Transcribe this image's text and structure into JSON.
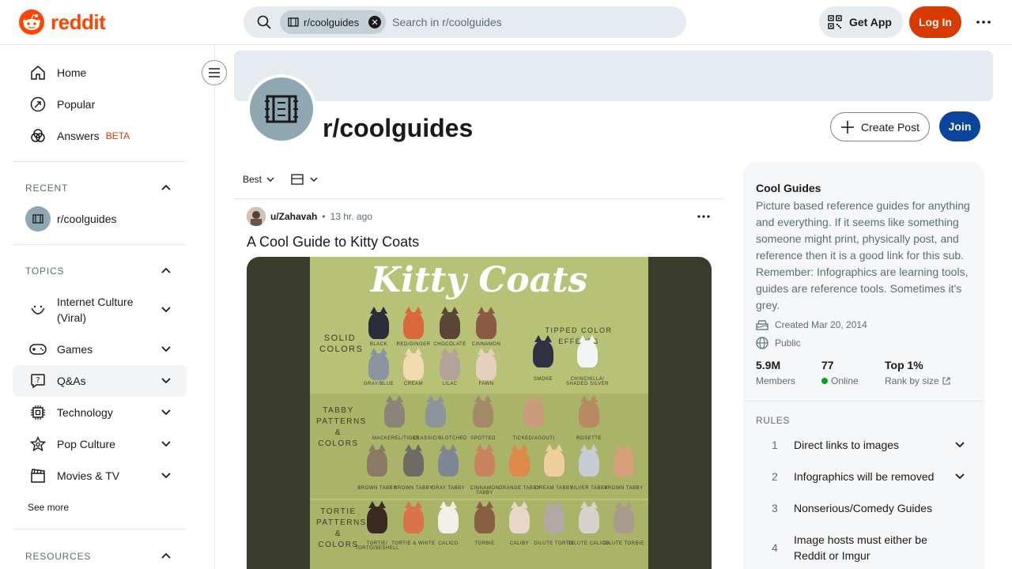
{
  "header": {
    "logo_text": "reddit",
    "search_chip": "r/coolguides",
    "search_placeholder": "Search in r/coolguides",
    "get_app_label": "Get App",
    "login_label": "Log In"
  },
  "sidebar": {
    "main": [
      {
        "label": "Home",
        "icon": "home-icon"
      },
      {
        "label": "Popular",
        "icon": "popular-icon"
      },
      {
        "label": "Answers",
        "badge": "BETA",
        "icon": "answers-icon"
      }
    ],
    "recent_title": "RECENT",
    "recent": [
      {
        "label": "r/coolguides"
      }
    ],
    "topics_title": "TOPICS",
    "topics": [
      {
        "label": "Internet Culture",
        "label2": "(Viral)",
        "icon": "smile-icon"
      },
      {
        "label": "Games",
        "icon": "gamepad-icon"
      },
      {
        "label": "Q&As",
        "icon": "question-icon"
      },
      {
        "label": "Technology",
        "icon": "chip-icon"
      },
      {
        "label": "Pop Culture",
        "icon": "star-icon"
      },
      {
        "label": "Movies & TV",
        "icon": "clapper-icon"
      }
    ],
    "see_more": "See more",
    "resources_title": "RESOURCES"
  },
  "community": {
    "name": "r/coolguides",
    "create_post_label": "Create Post",
    "join_label": "Join"
  },
  "feed": {
    "sort_label": "Best"
  },
  "post": {
    "author": "u/Zahavah",
    "separator": "•",
    "time": "13 hr. ago",
    "title": "A Cool Guide to Kitty Coats",
    "image": {
      "title": "Kitty Coats",
      "sections": [
        {
          "label": "SOLID\nCOLORS"
        },
        {
          "label": "TABBY\nPATTERNS\n& COLORS"
        },
        {
          "label": "TORTIE\nPATTERNS\n& COLORS"
        }
      ],
      "tipped_label": "TIPPED COLOR EFFECTS",
      "captions": {
        "solid": [
          "BLACK",
          "RED/GINGER",
          "CHOCOLATE",
          "CINNAMON"
        ],
        "solid2": [
          "GRAY/BLUE",
          "CREAM",
          "LILAC",
          "FAWN"
        ],
        "tipped": [
          "SMOKE",
          "CHINCHILLA/ SHADED SILVER"
        ],
        "tabby": [
          "MACKEREL/TIGER",
          "CLASSIC/BLOTCHED",
          "SPOTTED",
          "TICKED/AGOUTI",
          "ROSETTE"
        ],
        "tabby2": [
          "BROWN TABBY",
          "BROWN TABBY",
          "GRAY TABBY",
          "CINNAMON TABBY",
          "ORANGE TABBY",
          "CREAM TABBY",
          "SILVER TABBY",
          "BROWN TABBY"
        ],
        "tortie": [
          "TORTIE/ TORTOISESHELL",
          "TORTIE & WHITE",
          "CALICO",
          "TORBIE",
          "CALIBY",
          "DILUTE TORTIE",
          "DILUTE CALICO",
          "DILUTE TORBIE"
        ]
      },
      "colors": {
        "solid": [
          "#2b2e3a",
          "#d9693a",
          "#5a4536",
          "#8a5a44"
        ],
        "solid2": [
          "#8b94a0",
          "#f1d9b0",
          "#b3a297",
          "#e8cfbd"
        ],
        "tipped": [
          "#2f3244",
          "#f3f4f6"
        ],
        "tabby": [
          "#8c8478",
          "#8e949c",
          "#a58a6a",
          "#c99b7a",
          "#b98a62"
        ],
        "tabby2": [
          "#8a7a66",
          "#6f6a63",
          "#7f8796",
          "#c9835f",
          "#e08a4a",
          "#f0cf9e",
          "#c7cbd2",
          "#d8a07a"
        ],
        "tortie": [
          "#3b2a22",
          "#d8734a",
          "#f2f0ea",
          "#8a5e44",
          "#e8d6c8",
          "#b3a8a6",
          "#d8d2cc",
          "#a89b8c"
        ]
      }
    }
  },
  "about": {
    "title": "Cool Guides",
    "description": "Picture based reference guides for anything and everything. If it seems like something someone might print, physically post, and reference then it is a good link for this sub. Remember: Infographics are learning tools, guides are reference tools. Sometimes it's grey.",
    "created": "Created Mar 20, 2014",
    "visibility": "Public",
    "members_value": "5.9M",
    "members_label": "Members",
    "online_value": "77",
    "online_label": "Online",
    "rank_value": "Top 1%",
    "rank_label": "Rank by size",
    "rules_title": "RULES",
    "rules": [
      {
        "num": "1",
        "text": "Direct links to images"
      },
      {
        "num": "2",
        "text": "Infographics will be removed"
      },
      {
        "num": "3",
        "text": "Nonserious/Comedy Guides"
      },
      {
        "num": "4",
        "text": "Image hosts must either be Reddit or Imgur"
      }
    ]
  },
  "colors": {
    "brand": "#ff4500",
    "login": "#d93a00",
    "join": "#0a449b",
    "online": "#01a816"
  }
}
